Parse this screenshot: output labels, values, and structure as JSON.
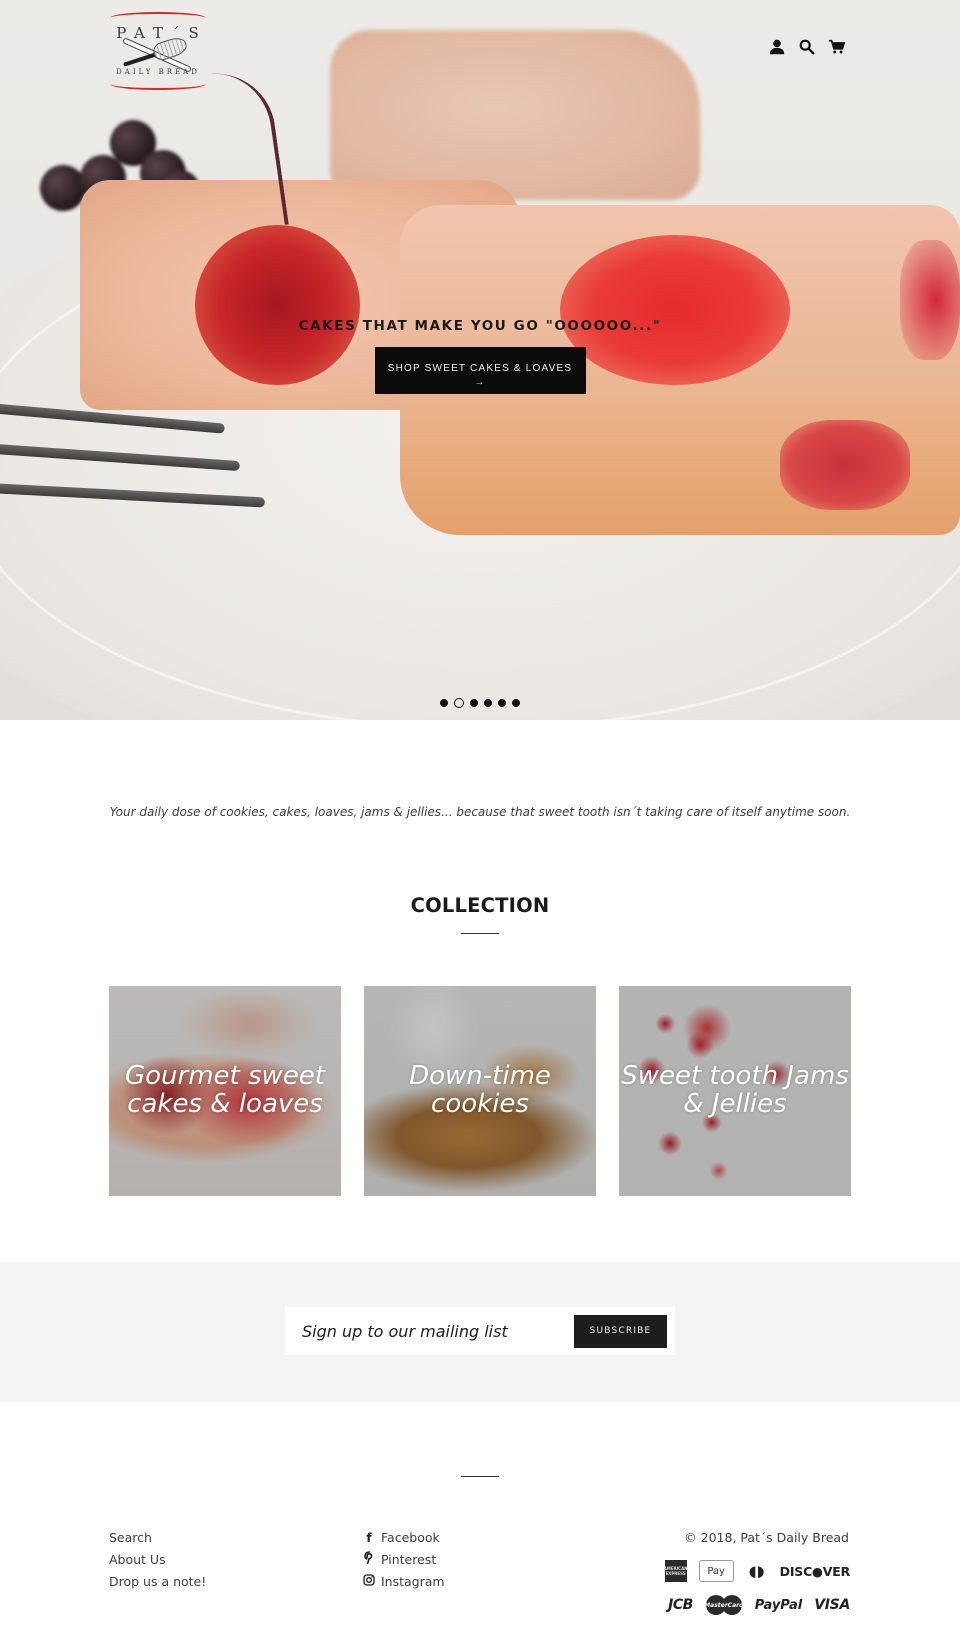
{
  "brand": {
    "logo_title": "PAT´S",
    "logo_subtitle": "DAILY BREAD",
    "accent_color": "#d12a2a"
  },
  "header": {
    "icons": [
      {
        "name": "account-icon",
        "label": "Log in"
      },
      {
        "name": "search-icon",
        "label": "Search"
      },
      {
        "name": "cart-icon",
        "label": "Cart"
      }
    ]
  },
  "hero": {
    "title": "CAKES THAT MAKE YOU GO \"OOOOOO...\"",
    "button_label": "SHOP SWEET CAKES & LOAVES",
    "button_arrow": "→",
    "slides_total": 6,
    "active_slide": 2
  },
  "tagline": "Your daily dose of cookies, cakes, loaves, jams & jellies... because that sweet tooth isn´t taking care of itself anytime soon.",
  "collection": {
    "title": "COLLECTION",
    "items": [
      {
        "label": "Gourmet sweet\ncakes & loaves"
      },
      {
        "label": "Down-time\ncookies"
      },
      {
        "label": "Sweet tooth Jams\n& Jellies"
      }
    ]
  },
  "newsletter": {
    "placeholder": "Sign up to our mailing list",
    "value": "",
    "button_label": "SUBSCRIBE"
  },
  "footer": {
    "links": [
      "Search",
      "About Us",
      "Drop us a note!"
    ],
    "social": [
      {
        "icon": "facebook-icon",
        "glyph": "f",
        "label": "Facebook"
      },
      {
        "icon": "pinterest-icon",
        "glyph": "℗",
        "label": "Pinterest"
      },
      {
        "icon": "instagram-icon",
        "glyph": "◎",
        "label": "Instagram"
      }
    ],
    "copyright": "© 2018, Pat´s Daily Bread",
    "payments": {
      "amex": "AMERICAN EXPRESS",
      "applepay": " Pay",
      "diners": "◖◗",
      "discover": "DISC●VER",
      "jcb": "JCB",
      "mastercard": "MasterCard",
      "paypal": "PayPal",
      "visa": "VISA"
    }
  }
}
